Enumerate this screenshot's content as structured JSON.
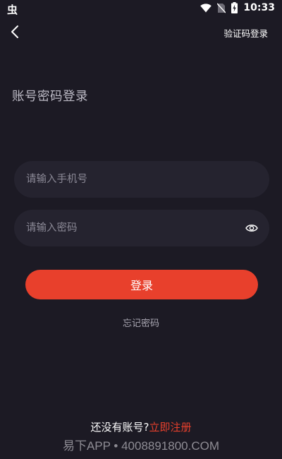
{
  "status_bar": {
    "left_glyph": "虫",
    "time": "10:33",
    "icons": [
      "wifi-icon",
      "no-sim-icon",
      "battery-charging-icon"
    ]
  },
  "header": {
    "back_icon": "chevron-left-icon",
    "sms_login_label": "验证码登录"
  },
  "page": {
    "title": "账号密码登录"
  },
  "form": {
    "phone_placeholder": "请输入手机号",
    "phone_value": "",
    "password_placeholder": "请输入密码",
    "password_value": "",
    "password_toggle_icon": "eye-icon",
    "login_label": "登录",
    "forgot_label": "忘记密码"
  },
  "footer": {
    "no_account_text": "还没有账号?",
    "register_label": "立即注册"
  },
  "watermark": {
    "text": "易下APP • 4008891800.COM"
  },
  "colors": {
    "background": "#1c1a24",
    "input_background": "#25232f",
    "accent": "#e8402c"
  }
}
